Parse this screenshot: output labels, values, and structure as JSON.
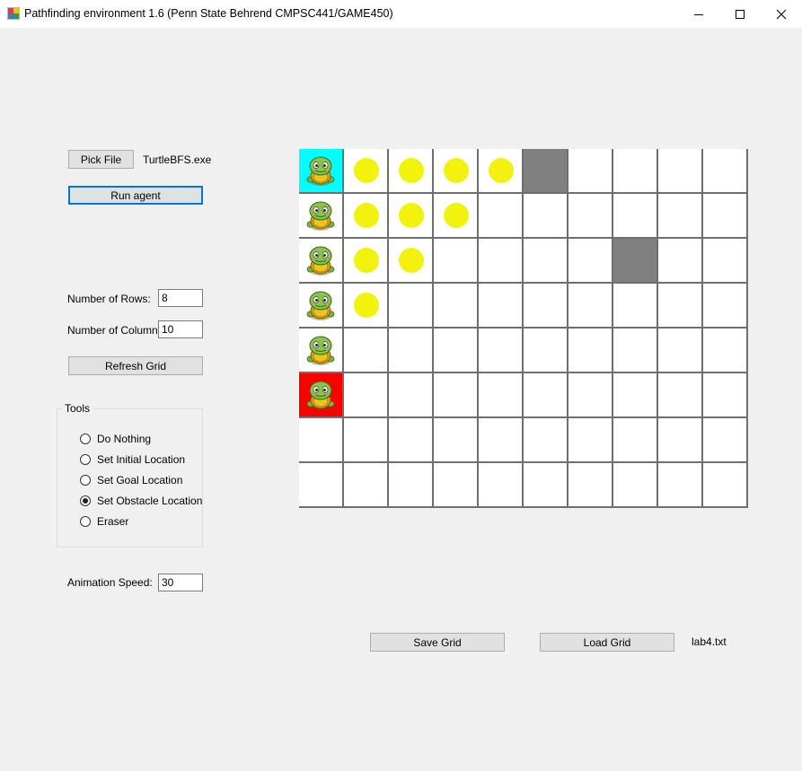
{
  "window": {
    "title": "Pathfinding environment 1.6 (Penn State Behrend CMPSC441/GAME450)"
  },
  "controls": {
    "pick_file_label": "Pick File",
    "agent_file": "TurtleBFS.exe",
    "run_agent_label": "Run agent",
    "rows_label": "Number of Rows:",
    "rows_value": "8",
    "cols_label": "Number of Columns:",
    "cols_value": "10",
    "refresh_label": "Refresh Grid",
    "tools_title": "Tools",
    "tools": [
      {
        "label": "Do Nothing",
        "checked": false
      },
      {
        "label": "Set Initial Location",
        "checked": false
      },
      {
        "label": "Set Goal Location",
        "checked": false
      },
      {
        "label": "Set Obstacle Location",
        "checked": true
      },
      {
        "label": "Eraser",
        "checked": false
      }
    ],
    "speed_label": "Animation Speed:",
    "speed_value": "30",
    "save_label": "Save Grid",
    "load_label": "Load Grid",
    "grid_file": "lab4.txt"
  },
  "grid": {
    "rows": 8,
    "cols": 10,
    "start": [
      0,
      0
    ],
    "goal": [
      5,
      0
    ],
    "obstacles": [
      [
        0,
        5
      ],
      [
        2,
        7
      ]
    ],
    "visited": [
      [
        0,
        1
      ],
      [
        0,
        2
      ],
      [
        0,
        3
      ],
      [
        0,
        4
      ],
      [
        1,
        1
      ],
      [
        1,
        2
      ],
      [
        1,
        3
      ],
      [
        2,
        1
      ],
      [
        2,
        2
      ],
      [
        3,
        1
      ]
    ],
    "path": [
      [
        0,
        0
      ],
      [
        1,
        0
      ],
      [
        2,
        0
      ],
      [
        3,
        0
      ],
      [
        4,
        0
      ],
      [
        5,
        0
      ]
    ]
  },
  "colors": {
    "start": "#00ffff",
    "goal": "#ff0000",
    "obstacle": "#808080",
    "visited": "#f2f20c",
    "focus": "#0078d7"
  },
  "icons": {
    "app": "app-grid-icon",
    "agent": "turtle-icon",
    "minimize": "minimize-icon",
    "maximize": "maximize-icon",
    "close": "close-icon"
  }
}
